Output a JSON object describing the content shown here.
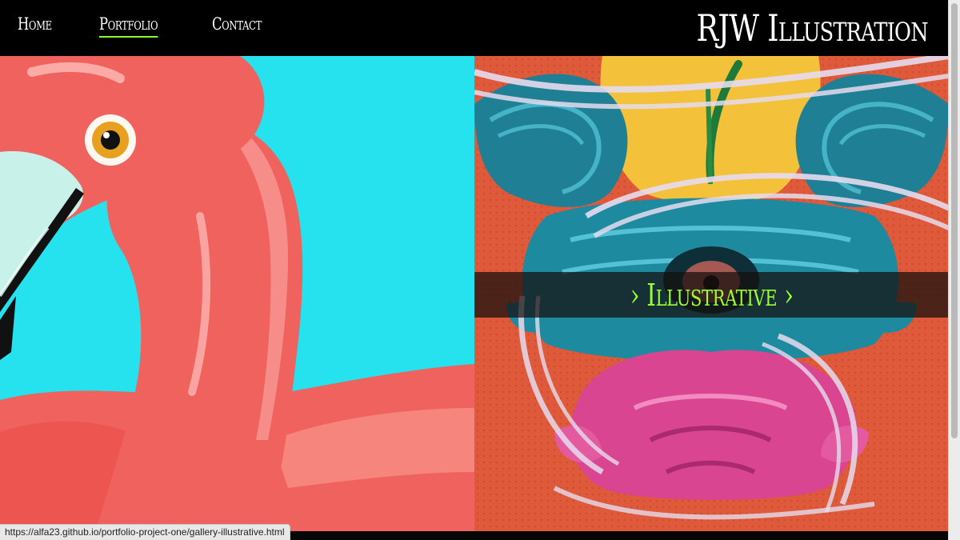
{
  "header": {
    "brand": "RJW Illustration",
    "nav": [
      {
        "label": "Home",
        "active": false
      },
      {
        "label": "Portfolio",
        "active": true
      },
      {
        "label": "Contact",
        "active": false
      }
    ]
  },
  "gallery": {
    "right_panel": {
      "label": "› Illustrative ›"
    }
  },
  "status_bar": {
    "url": "https://alfa23.github.io/portfolio-project-one/gallery-illustrative.html"
  },
  "colors": {
    "header_bg": "#000000",
    "nav_text": "#ffffff",
    "active_underline": "#8cff2a",
    "banner_text": "#9cff2e",
    "flamingo_bg": "#25e2ee",
    "flamingo_pink": "#f0625e",
    "illustration_bg": "#de5a3a"
  },
  "icons": {
    "left_panel_image": "flamingo-illustration",
    "right_panel_image": "creature-illustration"
  }
}
